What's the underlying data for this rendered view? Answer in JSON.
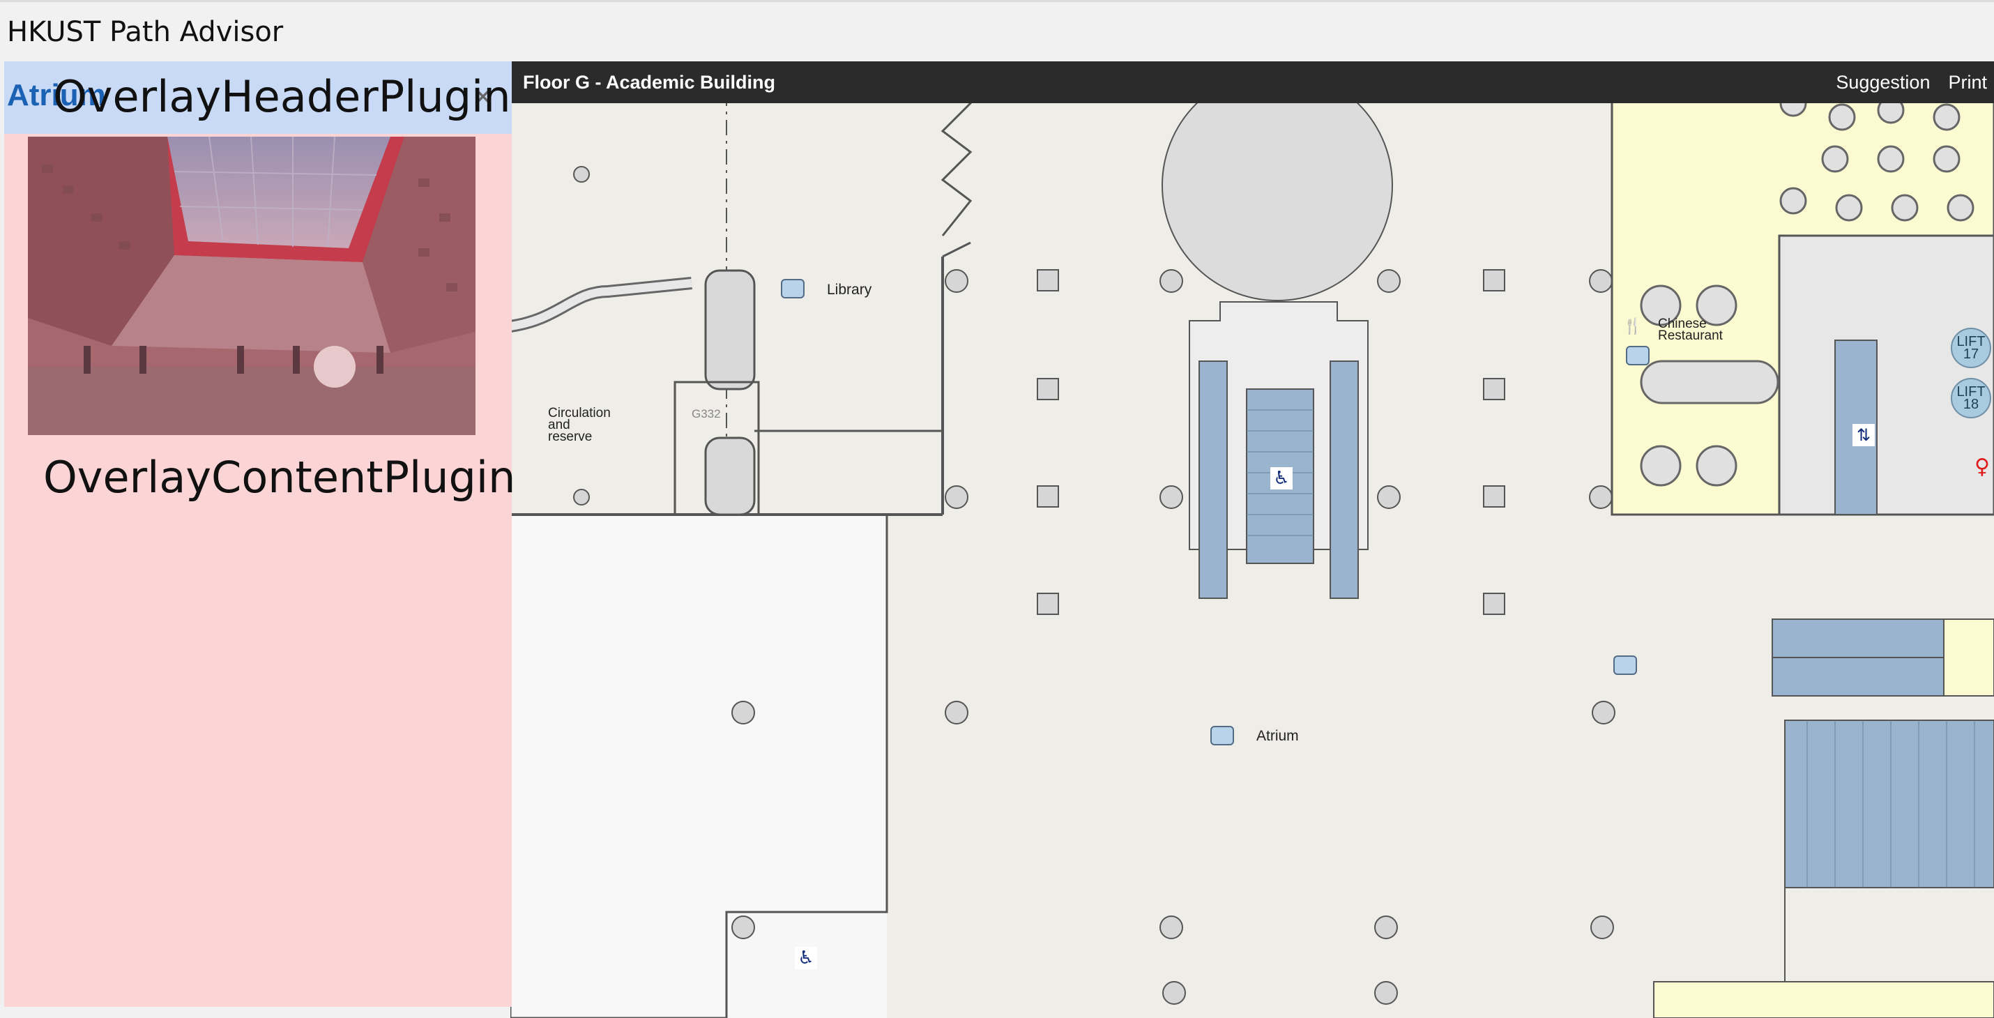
{
  "app": {
    "title": "HKUST Path Advisor"
  },
  "map": {
    "floor_title": "Floor G - Academic Building",
    "actions": [
      "Suggestion",
      "Print"
    ],
    "labels": {
      "library": "Library",
      "circulation": "Circulation\nand\nreserve",
      "room_g332": "G332",
      "chinese_restaurant": "Chinese\nRestaurant",
      "atrium": "Atrium",
      "lift_17": "LIFT\n17",
      "lift_18": "LIFT\n18"
    },
    "icons": [
      "camera-icon",
      "escalator-icon",
      "lift-icon",
      "restaurant-icon",
      "restroom-icon",
      "close-icon"
    ]
  },
  "overlay": {
    "title": "Atrium",
    "close": "×",
    "header_plugin": "OverlayHeaderPlugin",
    "content_plugin": "OverlayContentPlugin"
  }
}
